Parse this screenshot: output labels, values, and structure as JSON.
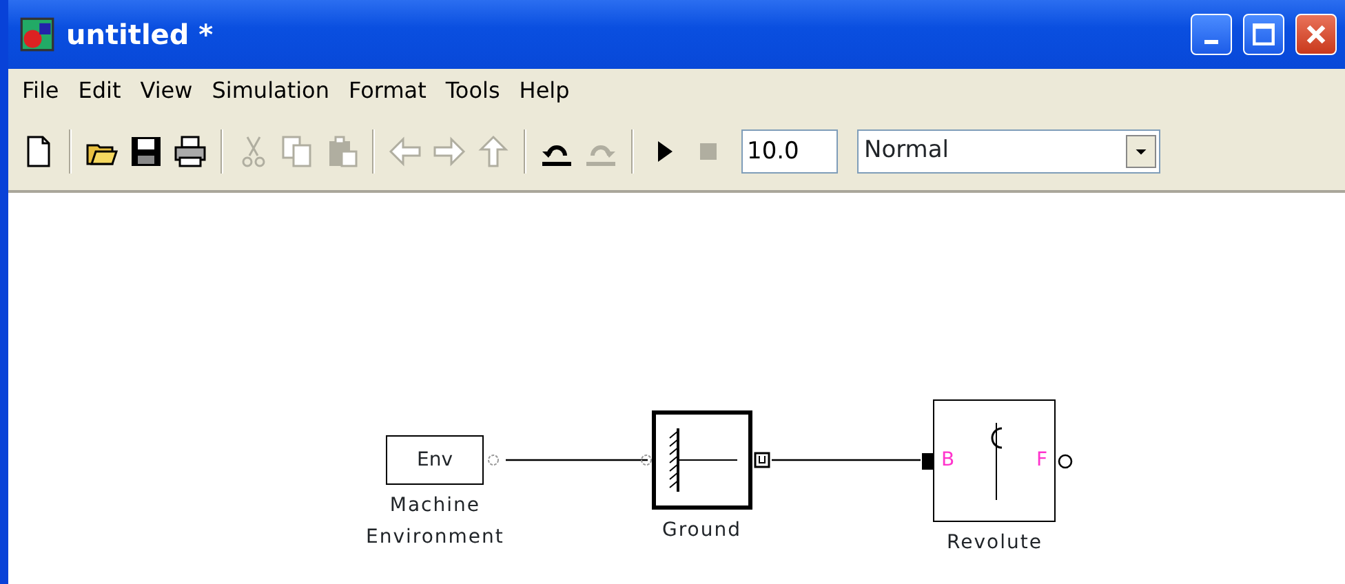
{
  "window": {
    "title": "untitled *"
  },
  "menu": [
    {
      "label": "File"
    },
    {
      "label": "Edit"
    },
    {
      "label": "View"
    },
    {
      "label": "Simulation"
    },
    {
      "label": "Format"
    },
    {
      "label": "Tools"
    },
    {
      "label": "Help"
    }
  ],
  "toolbar": {
    "groups": [
      [
        {
          "kind": "new",
          "disabled": false
        }
      ],
      [
        {
          "kind": "open",
          "disabled": false
        },
        {
          "kind": "save",
          "disabled": false
        },
        {
          "kind": "print",
          "disabled": false
        }
      ],
      [
        {
          "kind": "cut",
          "disabled": true
        },
        {
          "kind": "copy",
          "disabled": true
        },
        {
          "kind": "paste",
          "disabled": true
        }
      ],
      [
        {
          "kind": "back",
          "disabled": true
        },
        {
          "kind": "forward",
          "disabled": true
        },
        {
          "kind": "up",
          "disabled": true
        }
      ],
      [
        {
          "kind": "undo",
          "disabled": false
        },
        {
          "kind": "redo",
          "disabled": true
        }
      ],
      [
        {
          "kind": "run",
          "disabled": false
        },
        {
          "kind": "stop",
          "disabled": true
        }
      ]
    ],
    "stop_time": "10.0",
    "mode": "Normal"
  },
  "diagram": {
    "blocks": [
      {
        "kind": "env",
        "text": "Env",
        "label_lines": [
          "Machine",
          "Environment"
        ]
      },
      {
        "kind": "ground",
        "label_lines": [
          "Ground"
        ]
      },
      {
        "kind": "revolute",
        "ports": [
          "B",
          "F"
        ],
        "label_lines": [
          "Revolute"
        ]
      }
    ]
  }
}
